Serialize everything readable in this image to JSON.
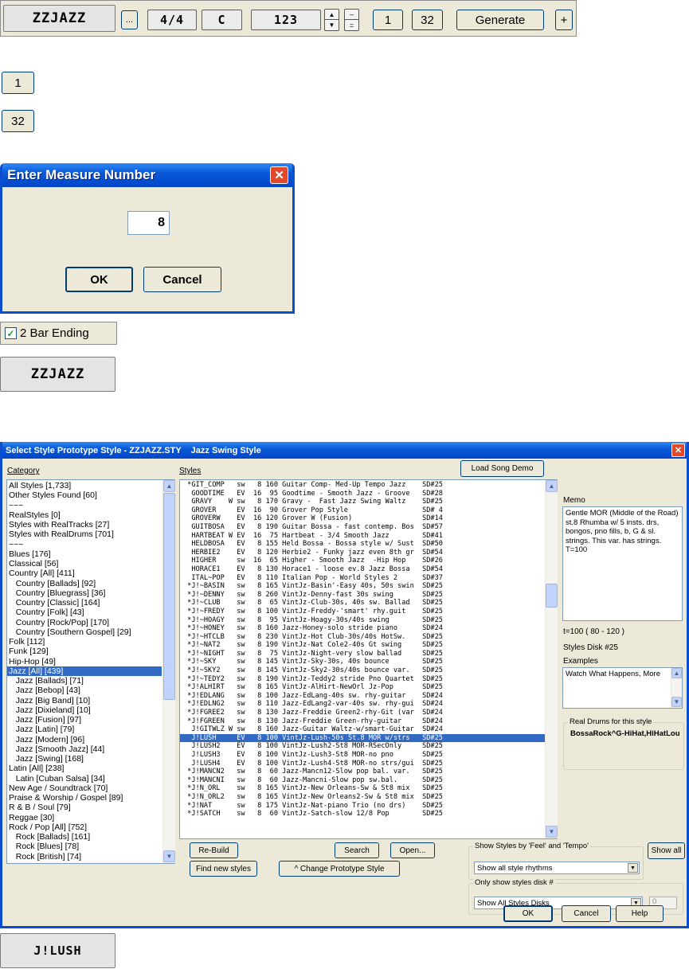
{
  "toolbar": {
    "style_name": "ZZJAZZ",
    "dots_label": "...",
    "time_sig": "4/4",
    "key": "C",
    "tempo": "123",
    "start_measure": "1",
    "end_measure": "32",
    "generate_label": "Generate",
    "plus_label": "+"
  },
  "standalone": {
    "btn_1": "1",
    "btn_32": "32"
  },
  "measure_dialog": {
    "title": "Enter Measure Number",
    "value": "8",
    "ok": "OK",
    "cancel": "Cancel"
  },
  "bar_ending": {
    "label": "2 Bar Ending",
    "checked": true
  },
  "style_name_box": "ZZJAZZ",
  "style_dialog": {
    "title": "Select Style Prototype Style - ZZJAZZ.STY    Jazz Swing Style",
    "category_label": "Category",
    "styles_label": "Styles",
    "load_demo": "Load Song Demo",
    "memo_label": "Memo",
    "memo_text": "Gentle MOR (Middle of the Road) st.8 Rhumba w/ 5 insts. drs, bongos, pno fills, b, G & sl. strings. This var. has strings. T=100",
    "tempo_range": "t=100 ( 80 - 120 )",
    "styles_disk": "Styles Disk #25",
    "examples_label": "Examples",
    "examples_text": "Watch What Happens, More",
    "real_drums_label": "Real Drums for this style",
    "real_drums_value": "BossaRock^G-HiHat,HiHatLou",
    "categories": [
      "All Styles [1,733]",
      "Other Styles Found [60]",
      "~~~",
      "RealStyles [0]",
      "Styles with RealTracks [27]",
      "Styles with RealDrums [701]",
      "~~~",
      "Blues [176]",
      "Classical [56]",
      "Country [All] [411]",
      "   Country [Ballads] [92]",
      "   Country [Bluegrass] [36]",
      "   Country [Classic] [164]",
      "   Country [Folk] [43]",
      "   Country [Rock/Pop] [170]",
      "   Country [Southern Gospel] [29]",
      "Folk [112]",
      "Funk [129]",
      "Hip-Hop [49]",
      "Jazz [All] [439]",
      "   Jazz [Ballads] [71]",
      "   Jazz [Bebop] [43]",
      "   Jazz [Big Band] [10]",
      "   Jazz [Dixieland] [10]",
      "   Jazz [Fusion] [97]",
      "   Jazz [Latin] [79]",
      "   Jazz [Modern] [96]",
      "   Jazz [Smooth Jazz] [44]",
      "   Jazz [Swing] [168]",
      "Latin [All] [238]",
      "   Latin [Cuban Salsa] [34]",
      "New Age / Soundtrack [70]",
      "Praise & Worship / Gospel [89]",
      "R & B / Soul [79]",
      "Reggae [30]",
      "Rock / Pop [All] [752]",
      "   Rock [Ballads] [161]",
      "   Rock [Blues] [78]",
      "   Rock [British] [74]"
    ],
    "selected_category": 19,
    "styles": [
      " *GIT_COMP   sw   8 160 Guitar Comp- Med-Up Tempo Jazz    SD#25",
      "  GOODTIME   EV  16  95 Goodtime - Smooth Jazz - Groove   SD#28",
      "  GRAVY    W sw   8 170 Gravy -  Fast Jazz Swing Waltz    SD#25",
      "  GROVER     EV  16  90 Grover Pop Style                  SD# 4",
      "  GROVERW    EV  16 120 Grover W (Fusion)                 SD#14",
      "  GUITBOSA   EV   8 190 Guitar Bossa - fast contemp. Bos  SD#57",
      "  HARTBEAT W EV  16  75 Hartbeat - 3/4 Smooth Jazz        SD#41",
      "  HELDBOSA   EV   8 155 Held Bossa - Bossa style w/ Sust  SD#50",
      "  HERBIE2    EV   8 120 Herbie2 - Funky jazz even 8th gr  SD#54",
      "  HIGHER     sw  16  65 Higher - Smooth Jazz  -Hip Hop    SD#26",
      "  HORACE1    EV   8 130 Horace1 - loose ev.8 Jazz Bossa   SD#54",
      "  ITAL~POP   EV   8 110 Italian Pop - World Styles 2      SD#37",
      " *J!~BASIN   sw   8 165 VintJz-Basin'-Easy 40s, 50s swin  SD#25",
      " *J!~DENNY   sw   8 260 VintJz-Denny-fast 30s swing       SD#25",
      " *J!~CLUB    sw   8  65 VintJz-Club-30s, 40s sw. Ballad   SD#25",
      " *J!~FREDY   sw   8 100 VintJz-Freddy-'smart' rhy.guit    SD#25",
      " *J!~HOAGY   sw   8  95 VintJz-Hoagy-30s/40s swing        SD#25",
      " *J!~HONEY   sw   8 160 Jazz-Honey-solo stride piano      SD#24",
      " *J!~HTCLB   sw   8 230 VintJz-Hot Club-30s/40s HotSw.    SD#25",
      " *J!~NAT2    sw   8 190 VintJz-Nat Cole2-40s Gt swing     SD#25",
      " *J!~NIGHT   sw   8  75 VintJz-Night-very slow ballad     SD#25",
      " *J!~SKY     sw   8 145 VintJz-Sky-30s, 40s bounce        SD#25",
      " *J!~SKY2    sw   8 145 VintJz-Sky2-30s/40s bounce var.   SD#25",
      " *J!~TEDY2   sw   8 190 VintJz-Teddy2 stride Pno Quartet  SD#25",
      " *J!ALHIRT   sw   8 165 VintJz-AlHirt-NewOrl Jz-Pop       SD#25",
      " *J!EDLANG   sw   8 100 Jazz-EdLang-40s sw. rhy-guitar    SD#24",
      " *J!EDLNG2   sw   8 110 Jazz-EdLang2-var-40s sw. rhy-gui  SD#24",
      " *J!FGREE2   sw   8 130 Jazz-Freddie Green2-rhy-Git (var  SD#24",
      " *J!FGREEN   sw   8 130 Jazz-Freddie Green-rhy-guitar     SD#24",
      "  J!GITWLZ W sw   8 160 Jazz-Guitar Waltz-w/smart-Guitar  SD#24",
      "  J!LUSH     EV   8 100 VintJz-Lush-50s St.8 MOR w/strs   SD#25",
      "  J!LUSH2    EV   8 100 VintJz-Lush2-St8 MOR-RSecOnly     SD#25",
      "  J!LUSH3    EV   8 100 VintJz-Lush3-St8 MOR-no pno       SD#25",
      "  J!LUSH4    EV   8 100 VintJz-Lush4-St8 MOR-no strs/gui  SD#25",
      " *J!MANCN2   sw   8  60 Jazz-Mancn12-Slow pop bal. var.   SD#25",
      " *J!MANCNI   sw   8  60 Jazz-Mancni-Slow pop sw.bal.      SD#25",
      " *J!N_ORL    sw   8 165 VintJz-New Orleans-Sw & St8 mix   SD#25",
      " *J!N_ORL2   sw   8 165 VintJz-New Orleans2-Sw & St8 mix  SD#25",
      " *J!NAT      sw   8 175 VintJz-Nat-piano Trio (no drs)    SD#25",
      " *J!SATCH    sw   8  60 VintJz-Satch-slow 12/8 Pop        SD#25"
    ],
    "selected_style": 30,
    "rebuild": "Re-Build",
    "search": "Search",
    "open": "Open...",
    "find_new": "Find new styles",
    "change_proto": "^ Change Prototype Style",
    "feel_group": "Show Styles by 'Feel' and 'Tempo'",
    "feel_value": "Show all style rhythms",
    "show_all": "Show all",
    "disk_group": "Only show styles disk #",
    "disk_value": "Show All Styles Disks",
    "disk_num": "0",
    "ok": "OK",
    "cancel": "Cancel",
    "help": "Help"
  },
  "bottom_box": "J!LUSH",
  "colors": {
    "xp_title": "#0a5ad8",
    "xp_face": "#ece9d8",
    "selection": "#316ac5",
    "close_red": "#e04a2a"
  }
}
